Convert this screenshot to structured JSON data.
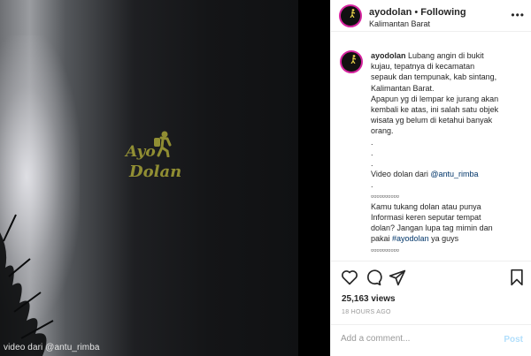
{
  "video": {
    "watermark_line1": "Ayo",
    "watermark_line2": "Dolan",
    "caption": "video dari @antu_rimba"
  },
  "header": {
    "username": "ayodolan",
    "separator": "•",
    "follow_status": "Following",
    "location": "Kalimantan Barat",
    "more_icon": "more-horizontal-icon"
  },
  "post": {
    "author": "ayodolan",
    "avatar_text": "AYO DOLAN",
    "lines": [
      "Lubang angin di bukit",
      "kujau, tepatnya di kecamatan",
      "sepauk dan tempunak, kab sintang,",
      "Kalimantan Barat.",
      "Apapun yg di lempar ke jurang akan",
      "kembali ke atas, ini salah satu objek",
      "wisata yg belum di ketahui banyak",
      "orang.",
      ".",
      ".",
      ".",
      "Video dolan dari ",
      ".",
      "▫▫▫▫▫▫▫▫▫▫",
      "Kamu tukang dolan atau punya",
      "Informasi keren seputar tempat",
      "dolan? Jangan lupa tag mimin dan",
      "pakai ",
      "▫▫▫▫▫▫▫▫▫▫"
    ],
    "mention": "@antu_rimba",
    "hashtag": "#ayodolan",
    "hashtag_suffix": " ya guys"
  },
  "actions": {
    "icons": [
      "heart-icon",
      "comment-icon",
      "share-icon",
      "bookmark-icon"
    ],
    "views": "25,163 views",
    "timestamp": "18 HOURS AGO"
  },
  "comment_box": {
    "placeholder": "Add a comment...",
    "post_label": "Post"
  },
  "colors": {
    "link": "#003569",
    "post_disabled": "#b2dffc",
    "avatar_ring": "#d6249f"
  }
}
